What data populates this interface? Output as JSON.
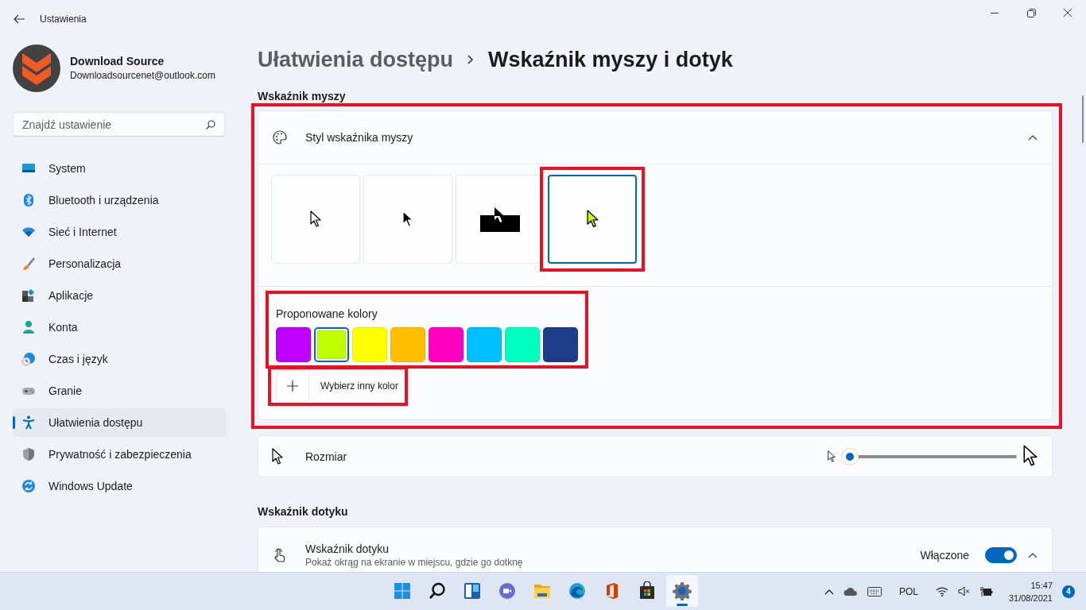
{
  "window": {
    "title": "Ustawienia"
  },
  "profile": {
    "name": "Download Source",
    "email": "Downloadsourcenet@outlook.com"
  },
  "search": {
    "placeholder": "Znajdź ustawienie"
  },
  "sidebar": {
    "items": [
      {
        "label": "System",
        "kind": "system",
        "selected": false
      },
      {
        "label": "Bluetooth i urządzenia",
        "kind": "bluetooth",
        "selected": false
      },
      {
        "label": "Sieć i Internet",
        "kind": "network",
        "selected": false
      },
      {
        "label": "Personalizacja",
        "kind": "personalization",
        "selected": false
      },
      {
        "label": "Aplikacje",
        "kind": "apps",
        "selected": false
      },
      {
        "label": "Konta",
        "kind": "accounts",
        "selected": false
      },
      {
        "label": "Czas i język",
        "kind": "time",
        "selected": false
      },
      {
        "label": "Granie",
        "kind": "gaming",
        "selected": false
      },
      {
        "label": "Ułatwienia dostępu",
        "kind": "accessibility",
        "selected": true
      },
      {
        "label": "Prywatność i zabezpieczenia",
        "kind": "privacy",
        "selected": false
      },
      {
        "label": "Windows Update",
        "kind": "update",
        "selected": false
      }
    ]
  },
  "breadcrumb": {
    "parent": "Ułatwienia dostępu",
    "current": "Wskaźnik myszy i dotyk"
  },
  "mouse_pointer": {
    "heading": "Wskaźnik myszy",
    "highlighted": true,
    "style_card": {
      "title": "Styl wskaźnika myszy",
      "expanded": true,
      "styles": [
        {
          "kind": "white",
          "selected": false,
          "highlighted": false
        },
        {
          "kind": "black",
          "selected": false,
          "highlighted": false
        },
        {
          "kind": "inverted",
          "selected": false,
          "highlighted": false
        },
        {
          "kind": "custom",
          "selected": true,
          "highlighted": true
        }
      ],
      "colors_label": "Proponowane kolory",
      "colors_highlighted": true,
      "colors": [
        {
          "color": "#c000ff",
          "selected": false
        },
        {
          "color": "#bfff00",
          "selected": true
        },
        {
          "color": "#ffff00",
          "selected": false
        },
        {
          "color": "#ffbf00",
          "selected": false
        },
        {
          "color": "#ff00bf",
          "selected": false
        },
        {
          "color": "#00bfff",
          "selected": false
        },
        {
          "color": "#00ffbf",
          "selected": false
        },
        {
          "color": "#1f3c88",
          "selected": false
        }
      ],
      "custom_color": {
        "label": "Wybierz inny kolor",
        "highlighted": true
      }
    },
    "size": {
      "label": "Rozmiar",
      "level": 0.0
    }
  },
  "touch": {
    "heading": "Wskaźnik dotyku",
    "title": "Wskaźnik dotyku",
    "description": "Pokaż okrąg na ekranie w miejscu, gdzie go dotknę",
    "state_label": "Włączone",
    "on": true,
    "expanded": true
  },
  "taskbar": {
    "apps": [
      {
        "kind": "start",
        "selected": false
      },
      {
        "kind": "search",
        "selected": false
      },
      {
        "kind": "widgets",
        "selected": false
      },
      {
        "kind": "chat",
        "selected": false
      },
      {
        "kind": "explorer",
        "selected": false
      },
      {
        "kind": "browser",
        "selected": false
      },
      {
        "kind": "office",
        "selected": false
      },
      {
        "kind": "store",
        "selected": false
      },
      {
        "kind": "settings",
        "selected": true
      }
    ],
    "language": "POL",
    "time": "15:47",
    "date": "31/08/2021",
    "notifications": "4"
  }
}
